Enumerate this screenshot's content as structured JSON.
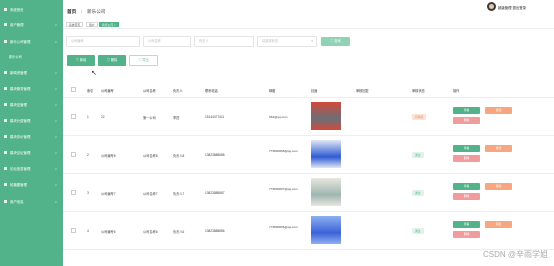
{
  "sidebar": {
    "items": [
      {
        "label": "系统首页"
      },
      {
        "label": "用户管理"
      },
      {
        "label": "新乐公司管理"
      },
      {
        "label": "新闻资管理"
      },
      {
        "label": "模块服务管理"
      },
      {
        "label": "模块征管理"
      },
      {
        "label": "模块计费管理"
      },
      {
        "label": "模块评价管理"
      },
      {
        "label": "模块论坛管理"
      },
      {
        "label": "论坛信息管理"
      },
      {
        "label": "轮播图管理"
      },
      {
        "label": "用户信息"
      }
    ],
    "sub": "新乐公司"
  },
  "header": {
    "breadcrumb_home": "首页",
    "breadcrumb_sep": "/",
    "breadcrumb_current": "新乐公司",
    "username": "超级管理 退出登录"
  },
  "tags": [
    {
      "label": "系统首页"
    },
    {
      "label": "用户"
    },
    {
      "label": "新乐公司 ×"
    }
  ],
  "search": {
    "placeholders": [
      "公司编号",
      "公司名称",
      "负责人",
      "请选择状态"
    ],
    "button": "查询"
  },
  "toolbar": {
    "add": "新增",
    "delete": "删除",
    "export": "导出"
  },
  "table": {
    "headers": [
      "索引",
      "公司编号",
      "公司名称",
      "负责人",
      "联系电话",
      "邮箱",
      "封面",
      "审核回复",
      "审核状态",
      "操作"
    ],
    "rows": [
      {
        "index": "1",
        "code": "22",
        "name": "第一公司",
        "owner": "李四",
        "phone": "15144477411",
        "email": "962@qq.com",
        "reply": "",
        "status": "待审核",
        "status_type": "pending"
      },
      {
        "index": "2",
        "code": "公司编号8",
        "name": "公司名称8",
        "owner": "负责人8",
        "phone": "13823888888",
        "email": "773890008@qq.com",
        "reply": "",
        "status": "通过",
        "status_type": "ok"
      },
      {
        "index": "3",
        "code": "公司编号7",
        "name": "公司名称7",
        "owner": "负责人7",
        "phone": "13823888887",
        "email": "773890007@qq.com",
        "reply": "",
        "status": "通过",
        "status_type": "ok"
      },
      {
        "index": "4",
        "code": "公司编号6",
        "name": "公司名称6",
        "owner": "负责人6",
        "phone": "13823888886",
        "email": "773890006@qq.com",
        "reply": "",
        "status": "通过",
        "status_type": "ok"
      }
    ],
    "action_view": "查看",
    "action_edit": "修改",
    "action_delete": "删除"
  },
  "watermark": "CSDN @辛雨学姐",
  "colors": {
    "primary": "#52b38a",
    "edit": "#f7a780",
    "delete": "#f19c9c"
  }
}
